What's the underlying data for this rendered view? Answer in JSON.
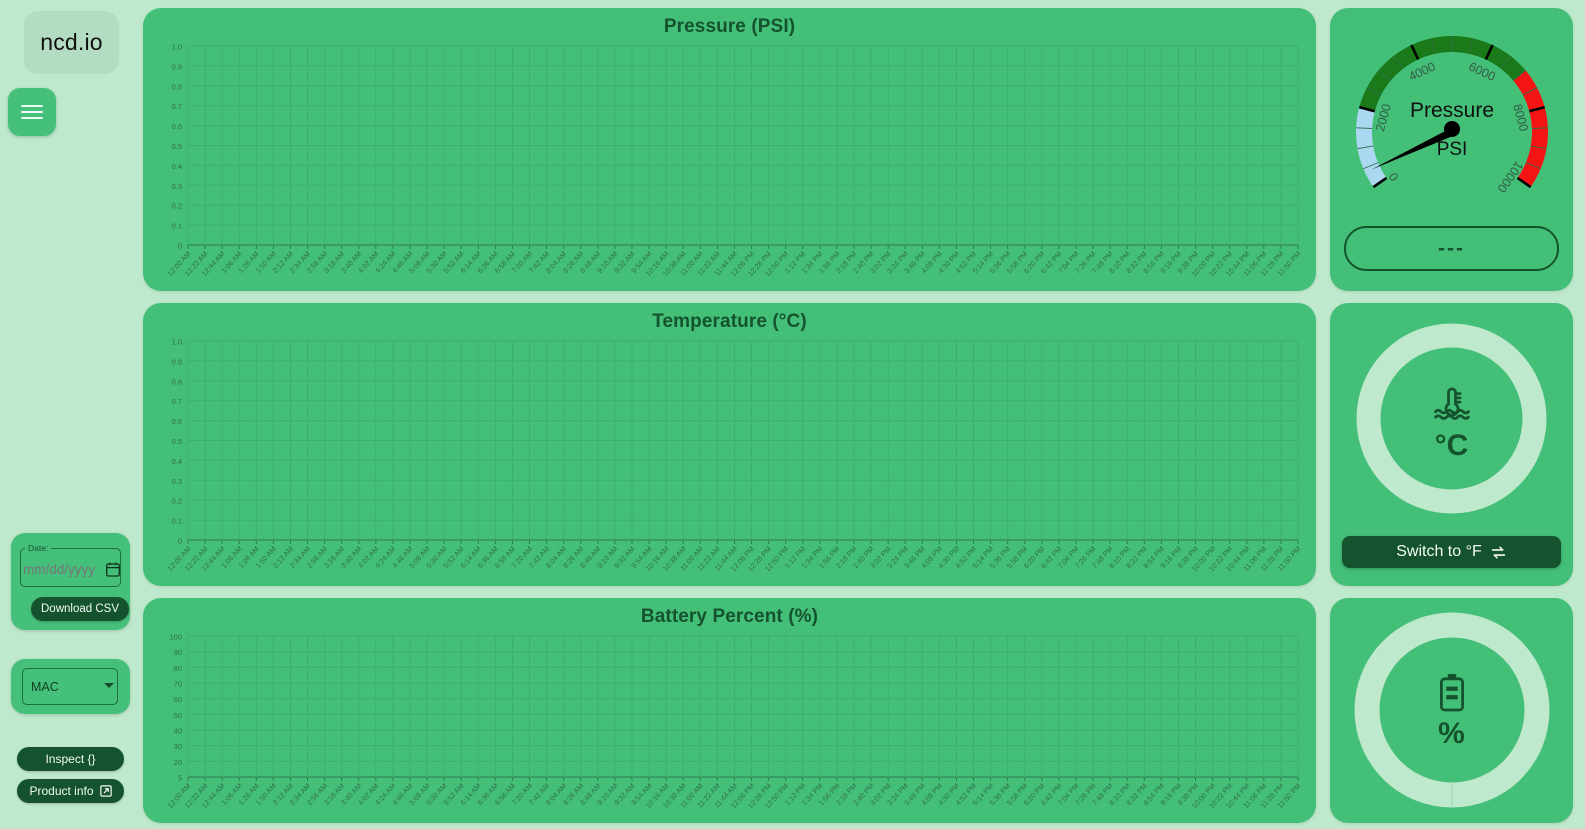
{
  "brand": {
    "logo_text": "ncd.io",
    "menu_icon": "hamburger-icon"
  },
  "sidebar": {
    "date_legend": "Date:",
    "date_value": "",
    "date_placeholder": "mm/dd/yyyy",
    "download_csv_label": "Download CSV",
    "mac_selected": "MAC",
    "mac_options": [
      "MAC"
    ],
    "inspect_label": "Inspect  {}",
    "product_info_label": "Product info"
  },
  "charts": [
    {
      "id": "pressure",
      "title": "Pressure (PSI)",
      "y_ticks": [
        "1.0",
        "0.9",
        "0.8",
        "0.7",
        "0.6",
        "0.5",
        "0.4",
        "0.3",
        "0.2",
        "0.1",
        "0"
      ]
    },
    {
      "id": "temperature",
      "title": "Temperature (°C)",
      "y_ticks": [
        "1.0",
        "0.9",
        "0.8",
        "0.7",
        "0.6",
        "0.5",
        "0.4",
        "0.3",
        "0.2",
        "0.1",
        "0"
      ]
    },
    {
      "id": "battery",
      "title": "Battery Percent (%)",
      "y_ticks": [
        "100",
        "90",
        "80",
        "70",
        "60",
        "50",
        "40",
        "30",
        "20",
        "5"
      ]
    }
  ],
  "x_ticks": [
    "12:00 AM",
    "12:22 AM",
    "12:44 AM",
    "1:06 AM",
    "1:28 AM",
    "1:50 AM",
    "2:12 AM",
    "2:34 AM",
    "2:56 AM",
    "3:18 AM",
    "3:40 AM",
    "4:02 AM",
    "4:24 AM",
    "4:46 AM",
    "5:08 AM",
    "5:30 AM",
    "5:52 AM",
    "6:14 AM",
    "6:36 AM",
    "6:58 AM",
    "7:20 AM",
    "7:42 AM",
    "8:04 AM",
    "8:26 AM",
    "8:48 AM",
    "9:10 AM",
    "9:32 AM",
    "9:54 AM",
    "10:16 AM",
    "10:38 AM",
    "11:00 AM",
    "11:22 AM",
    "11:44 AM",
    "12:06 PM",
    "12:28 PM",
    "12:50 PM",
    "1:12 PM",
    "1:34 PM",
    "1:56 PM",
    "2:18 PM",
    "2:40 PM",
    "3:02 PM",
    "3:24 PM",
    "3:46 PM",
    "4:08 PM",
    "4:30 PM",
    "4:52 PM",
    "5:14 PM",
    "5:36 PM",
    "5:58 PM",
    "6:20 PM",
    "6:42 PM",
    "7:04 PM",
    "7:26 PM",
    "7:48 PM",
    "8:10 PM",
    "8:32 PM",
    "8:54 PM",
    "9:16 PM",
    "9:38 PM",
    "10:00 PM",
    "10:22 PM",
    "10:44 PM",
    "11:06 PM",
    "11:28 PM",
    "11:50 PM"
  ],
  "gauge": {
    "title": "Pressure",
    "unit": "PSI",
    "tick_labels": [
      "0",
      "2000",
      "4000",
      "6000",
      "8000",
      "10000"
    ],
    "min": 0,
    "max": 10000,
    "value": null,
    "readout": "---",
    "band_low_color": "#a9d8f0",
    "band_mid_color": "#1a7a1a",
    "band_high_color": "#f51414"
  },
  "temperature_panel": {
    "icon": "thermometer-water-icon",
    "unit": "°C",
    "value": null,
    "ring_percent": 0,
    "switch_label": "Switch to °F",
    "switch_icon": "swap-icon"
  },
  "battery_panel": {
    "icon": "battery-icon",
    "unit": "%",
    "value": null,
    "ring_percent": 0
  },
  "chart_data": [
    {
      "type": "line",
      "title": "Pressure (PSI)",
      "xlabel": "",
      "ylabel": "",
      "x": [],
      "values": [],
      "ylim": [
        0,
        1.0
      ],
      "y_ticks": [
        0,
        0.1,
        0.2,
        0.3,
        0.4,
        0.5,
        0.6,
        0.7,
        0.8,
        0.9,
        1.0
      ],
      "grid": true,
      "legend": false,
      "note": "empty series - no data plotted"
    },
    {
      "type": "line",
      "title": "Temperature (°C)",
      "xlabel": "",
      "ylabel": "",
      "x": [],
      "values": [],
      "ylim": [
        0,
        1.0
      ],
      "y_ticks": [
        0,
        0.1,
        0.2,
        0.3,
        0.4,
        0.5,
        0.6,
        0.7,
        0.8,
        0.9,
        1.0
      ],
      "grid": true,
      "legend": false,
      "note": "empty series - no data plotted"
    },
    {
      "type": "line",
      "title": "Battery Percent (%)",
      "xlabel": "",
      "ylabel": "",
      "x": [],
      "values": [],
      "ylim": [
        5,
        100
      ],
      "y_ticks": [
        5,
        20,
        30,
        40,
        50,
        60,
        70,
        80,
        90,
        100
      ],
      "grid": true,
      "legend": false,
      "note": "empty series - no data plotted"
    }
  ],
  "theme": {
    "page_bg": "#bfe9cd",
    "panel_bg": "#44bf78",
    "dark_green": "#14532d",
    "ring_track": "#bfe9cd"
  }
}
